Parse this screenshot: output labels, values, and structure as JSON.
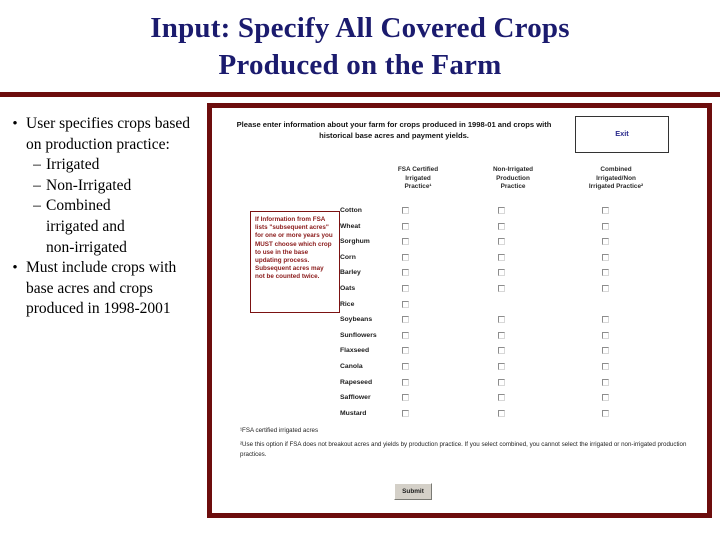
{
  "slide": {
    "title_lines": [
      "Input: Specify All Covered Crops",
      "Produced on the Farm"
    ],
    "title_color": "#1b1b6e",
    "rule_color": "#6d0d0d",
    "frame_border_color": "#6d0d0d"
  },
  "bullets": {
    "bullet_mark": "•",
    "sub_mark": "–",
    "items": [
      {
        "text": "User specifies crops based on production practice:",
        "subitems": [
          {
            "text": "Irrigated"
          },
          {
            "text": "Non-Irrigated"
          },
          {
            "text": "Combined",
            "continuation": [
              "irrigated and",
              "non-irrigated"
            ]
          }
        ]
      },
      {
        "text": "Must include crops with base acres and crops produced in 1998-2001",
        "subitems": []
      }
    ]
  },
  "app": {
    "instruction": "Please enter information about your farm for crops produced in 1998-01 and crops with historical base acres and payment yields.",
    "exit_label": "Exit",
    "submit_label": "Submit",
    "note_text": "If Information from FSA lists \"subsequent acres\" for one or more years you MUST choose which crop to use in the base updating process. Subsequent acres may not be counted twice.",
    "columns": [
      {
        "lines": [
          "FSA Certified",
          "Irrigated",
          "Practice¹"
        ]
      },
      {
        "lines": [
          "Non-Irrigated",
          "Production",
          "Practice"
        ]
      },
      {
        "lines": [
          "Combined",
          "Irrigated/Non",
          "Irrigated Practice²"
        ]
      }
    ],
    "rows": [
      {
        "crop": "Cotton",
        "checks": [
          true,
          true,
          true
        ]
      },
      {
        "crop": "Wheat",
        "checks": [
          true,
          true,
          true
        ]
      },
      {
        "crop": "Sorghum",
        "checks": [
          true,
          true,
          true
        ]
      },
      {
        "crop": "Corn",
        "checks": [
          true,
          true,
          true
        ]
      },
      {
        "crop": "Barley",
        "checks": [
          true,
          true,
          true
        ]
      },
      {
        "crop": "Oats",
        "checks": [
          true,
          true,
          true
        ]
      },
      {
        "crop": "Rice",
        "checks": [
          true,
          false,
          false
        ]
      },
      {
        "crop": "Soybeans",
        "checks": [
          true,
          true,
          true
        ]
      },
      {
        "crop": "Sunflowers",
        "checks": [
          true,
          true,
          true
        ]
      },
      {
        "crop": "Flaxseed",
        "checks": [
          true,
          true,
          true
        ]
      },
      {
        "crop": "Canola",
        "checks": [
          true,
          true,
          true
        ]
      },
      {
        "crop": "Rapeseed",
        "checks": [
          true,
          true,
          true
        ]
      },
      {
        "crop": "Safflower",
        "checks": [
          true,
          true,
          true
        ]
      },
      {
        "crop": "Mustard",
        "checks": [
          true,
          true,
          true
        ]
      }
    ],
    "footnotes": [
      "¹FSA certified irrigated acres",
      "²Use this option if FSA does not breakout acres and yields by production practice. If you select combined, you cannot select the irrigated or non-irrigated production practices."
    ]
  }
}
